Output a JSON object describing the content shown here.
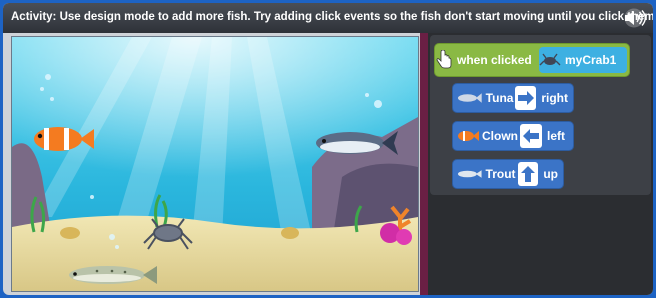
{
  "activity_text": "Activity: Use design mode to add more fish. Try adding click events so the fish don't start moving until you click them.",
  "speaker_icon": "speaker-icon",
  "event_block": {
    "label": "when clicked",
    "sprite": "myCrab1"
  },
  "commands": [
    {
      "fish": "Tuna",
      "direction": "right"
    },
    {
      "fish": "Clown",
      "direction": "left"
    },
    {
      "fish": "Trout",
      "direction": "up"
    }
  ],
  "colors": {
    "event": "#8ab944",
    "sprite": "#3db0e2",
    "command": "#3b74c7",
    "divider": "#6a1f44"
  }
}
